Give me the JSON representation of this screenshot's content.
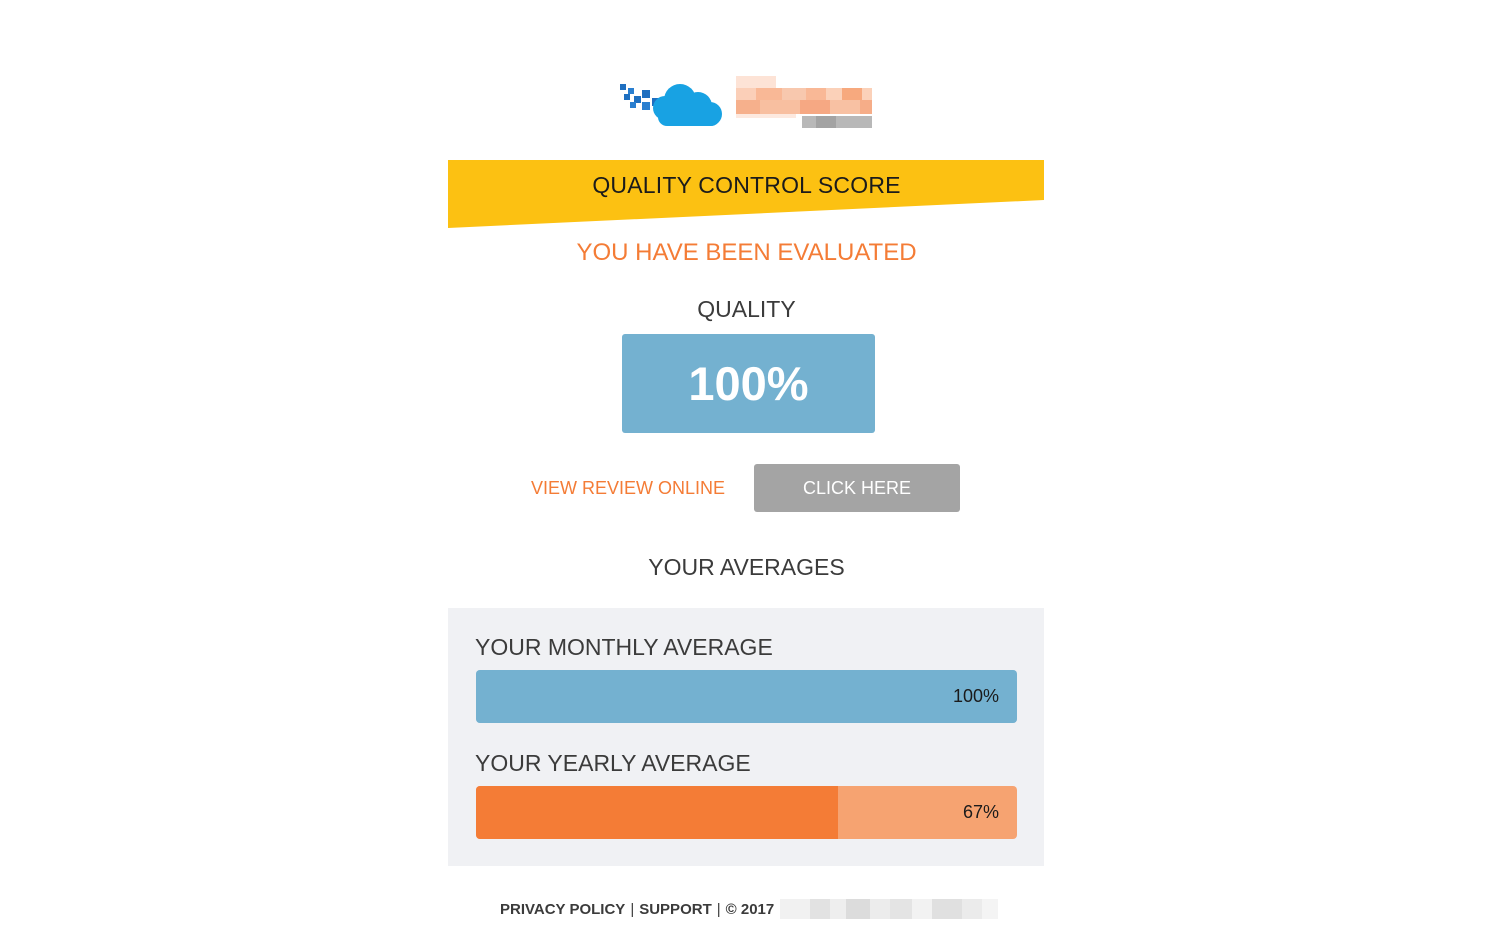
{
  "header": {
    "logo_name": "cloud-logo",
    "banner_title": "QUALITY CONTROL SCORE",
    "banner_color": "#fcc112"
  },
  "evaluation": {
    "headline": "YOU HAVE BEEN EVALUATED",
    "quality_label": "QUALITY",
    "quality_score": "100%"
  },
  "review": {
    "link_text": "VIEW REVIEW ONLINE",
    "button_label": "CLICK HERE"
  },
  "averages": {
    "title": "YOUR AVERAGES",
    "monthly": {
      "label": "YOUR MONTHLY AVERAGE",
      "value_text": "100%",
      "percent": 100
    },
    "yearly": {
      "label": "YOUR YEARLY AVERAGE",
      "value_text": "67%",
      "percent": 67
    }
  },
  "footer": {
    "privacy": "PRIVACY POLICY",
    "separator": "|",
    "support": "SUPPORT",
    "copyright": "© 2017"
  },
  "colors": {
    "accent_orange": "#f47c36",
    "accent_blue": "#74b1d0",
    "button_gray": "#a4a4a4",
    "panel_bg": "#f0f1f4"
  }
}
